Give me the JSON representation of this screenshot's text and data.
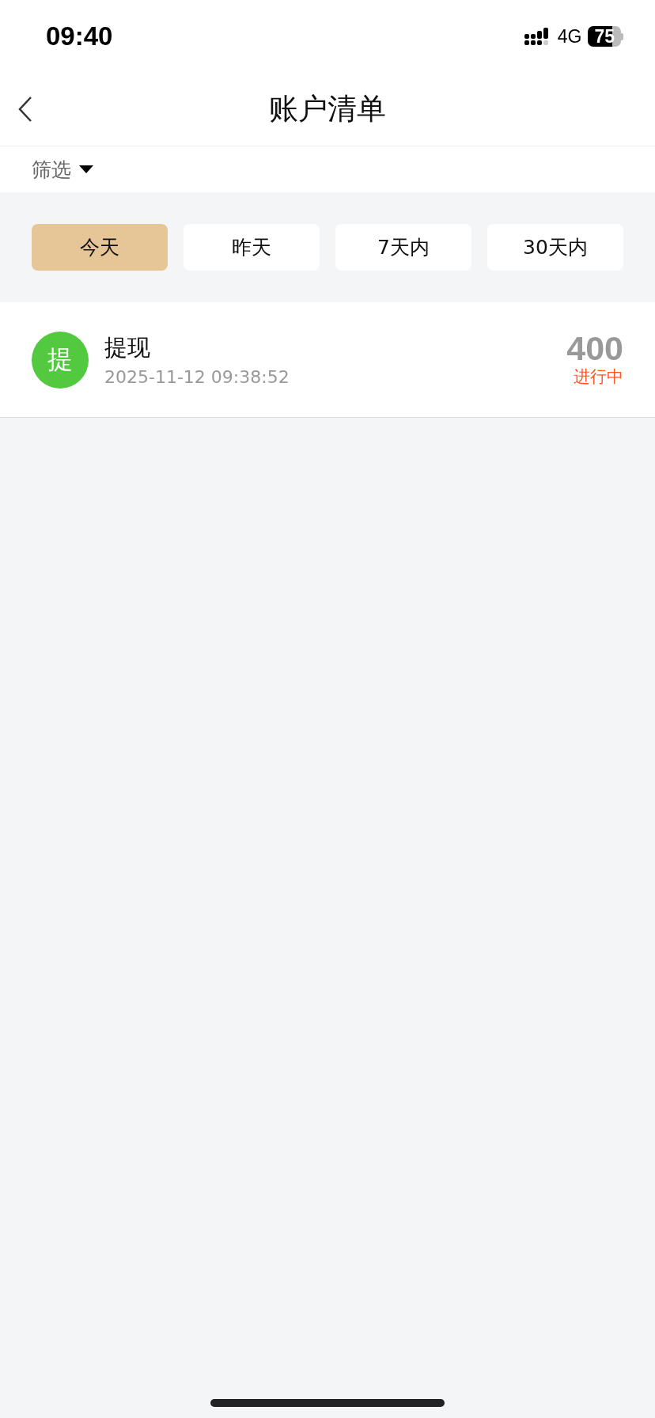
{
  "status_bar": {
    "time": "09:40",
    "network": "4G",
    "battery": "75"
  },
  "nav": {
    "title": "账户清单"
  },
  "filter": {
    "label": "筛选"
  },
  "tabs": [
    {
      "label": "今天",
      "selected": true
    },
    {
      "label": "昨天",
      "selected": false
    },
    {
      "label": "7天内",
      "selected": false
    },
    {
      "label": "30天内",
      "selected": false
    }
  ],
  "records": [
    {
      "avatar": "提",
      "color": "#52c93f",
      "title": "提现",
      "time": "2025-11-12 09:38:52",
      "amount": "400",
      "status": "进行中"
    }
  ]
}
